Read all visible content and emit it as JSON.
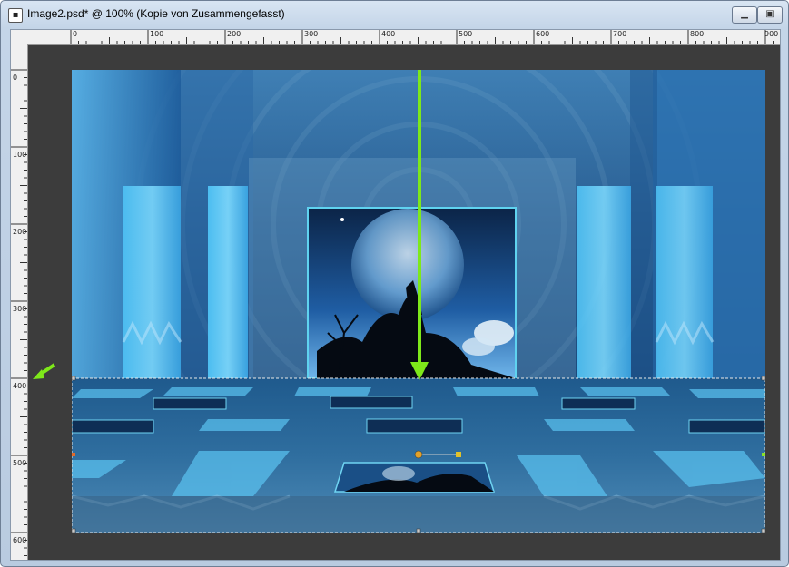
{
  "window": {
    "title": "Image2.psd* @ 100% (Kopie von Zusammengefasst)",
    "app_icon": "document-icon",
    "minimize_icon": "minimize-icon",
    "restore_icon": "restore-icon"
  },
  "rulers": {
    "horizontal_labels": [
      "0",
      "100",
      "200",
      "300",
      "400",
      "500",
      "600",
      "700",
      "800",
      "900"
    ],
    "vertical_labels": [
      "0",
      "100",
      "200",
      "300",
      "400",
      "500",
      "600"
    ]
  },
  "annotations": {
    "arrow_color": "#7ee81a",
    "vertical_arrow_icon": "arrow-down-icon",
    "side_arrow_icon": "arrow-left-down-icon"
  },
  "colors": {
    "canvas_background": "#3c3c3c",
    "accent_blue": "#3fa9e8",
    "deep_blue": "#0a3d72"
  }
}
